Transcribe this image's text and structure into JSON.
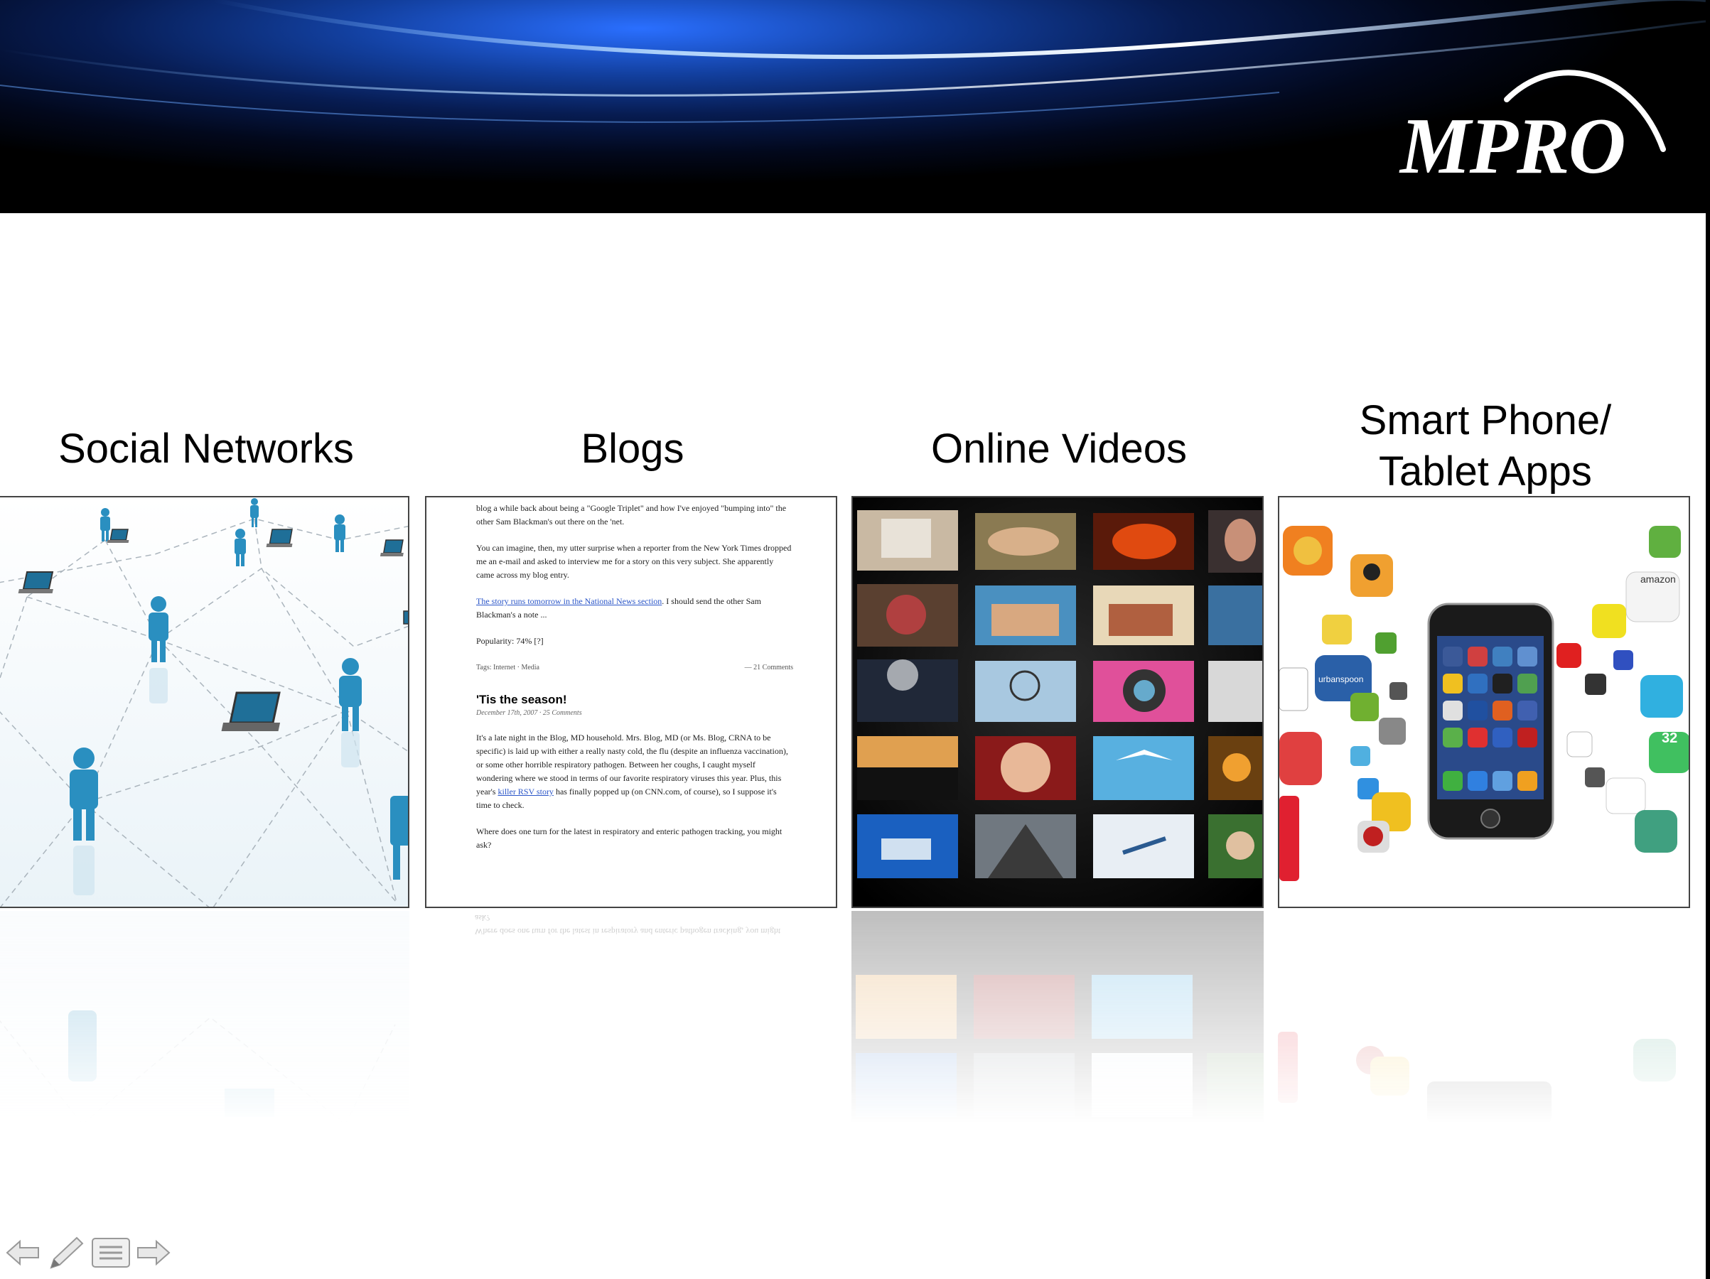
{
  "header": {
    "logo_text": "MPRO"
  },
  "columns": [
    {
      "id": "social",
      "title_lines": [
        "Social Networks"
      ]
    },
    {
      "id": "blogs",
      "title_lines": [
        "Blogs"
      ]
    },
    {
      "id": "videos",
      "title_lines": [
        "Online Videos"
      ]
    },
    {
      "id": "apps",
      "title_lines": [
        "Smart Phone/",
        "Tablet Apps"
      ]
    }
  ],
  "blog": {
    "para1": "blog a while back about being a \"Google Triplet\" and how I've enjoyed \"bumping into\" the other Sam Blackman's out there on the 'net.",
    "para2": "You can imagine, then, my utter surprise when a reporter from the New York Times dropped me an e-mail and asked to interview me for a story on this very subject. She apparently came across my blog entry.",
    "para3_link": "The story runs tomorrow in the National News section",
    "para3_rest": ". I should send the other Sam Blackman's a note ...",
    "popularity": "Popularity: 74% [?]",
    "tags": "Tags: Internet · Media",
    "comments": "— 21 Comments",
    "post_title": "'Tis the season!",
    "post_date": "December 17th, 2007 · 25 Comments",
    "para4": "It's a late night in the Blog, MD household. Mrs. Blog, MD (or Ms. Blog, CRNA to be specific) is laid up with either a really nasty cold, the flu (despite an influenza vaccination), or some other horrible respiratory pathogen. Between her coughs, I caught myself wondering where we stood in terms of our favorite respiratory viruses this year. Plus, this year's",
    "para4_link": "killer RSV story",
    "para4_rest": " has finally popped up (on CNN.com, of course), so I suppose it's time to check.",
    "para5": "Where does one turn for the latest in respiratory and enteric pathogen tracking, you might ask?"
  },
  "apps": {
    "amazon_label": "amazon",
    "urbanspoon_label": "urbanspoon",
    "badge_number": "32"
  },
  "nav": {
    "prev": "previous-slide",
    "pen": "pen-tool",
    "menu": "slide-menu",
    "next": "next-slide"
  },
  "colors": {
    "banner_blue": "#2a6fff",
    "figure_blue": "#2a8fc0"
  }
}
